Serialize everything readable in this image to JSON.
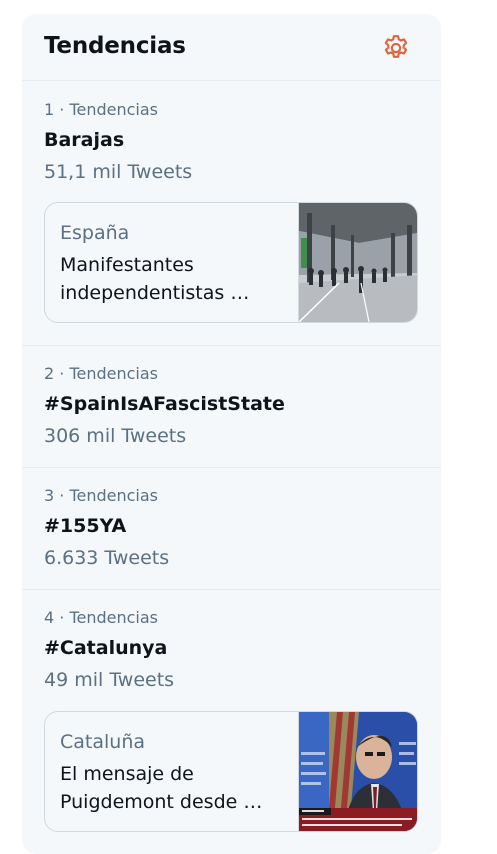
{
  "panel": {
    "title": "Tendencias",
    "settings_icon": "gear-icon",
    "accent_color": "#e0633b"
  },
  "trends": [
    {
      "meta": "1 · Tendencias",
      "name": "Barajas",
      "count": "51,1 mil Tweets",
      "card": {
        "source": "España",
        "headline": "Manifestantes independentistas …",
        "thumb": "airport-terminal-protest-photo"
      }
    },
    {
      "meta": "2 · Tendencias",
      "name": "#SpainIsAFascistState",
      "count": "306 mil Tweets"
    },
    {
      "meta": "3 · Tendencias",
      "name": "#155YA",
      "count": "6.633 Tweets"
    },
    {
      "meta": "4 · Tendencias",
      "name": "#Catalunya",
      "count": "49 mil Tweets",
      "card": {
        "source": "Cataluña",
        "headline": "El mensaje de Puigdemont desde …",
        "thumb": "press-conference-photo"
      }
    }
  ]
}
